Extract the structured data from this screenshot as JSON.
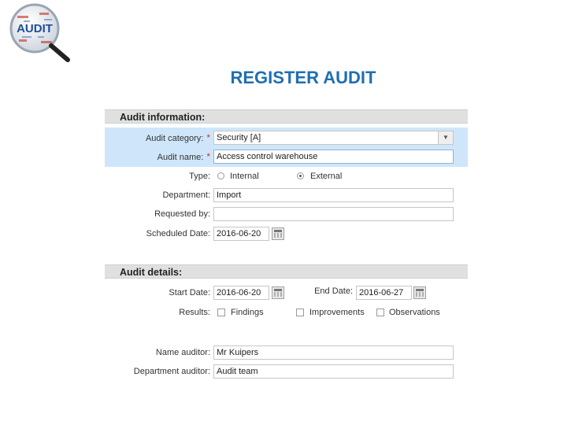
{
  "logo": {
    "text": "AUDIT"
  },
  "page_title": "REGISTER AUDIT",
  "audit_information": {
    "header": "Audit information:",
    "audit_category": {
      "label": "Audit category:",
      "required_mark": "*",
      "value": "Security [A]"
    },
    "audit_name": {
      "label": "Audit name:",
      "required_mark": "*",
      "value": "Access control warehouse"
    },
    "type": {
      "label": "Type:",
      "options": [
        "Internal",
        "External"
      ],
      "selected": "External"
    },
    "department": {
      "label": "Department:",
      "value": "Import"
    },
    "requested_by": {
      "label": "Requested by:",
      "value": ""
    },
    "scheduled_date": {
      "label": "Scheduled Date:",
      "value": "2016-06-20"
    }
  },
  "audit_details": {
    "header": "Audit details:",
    "start_date": {
      "label": "Start Date:",
      "value": "2016-06-20"
    },
    "end_date": {
      "label": "End Date:",
      "value": "2016-06-27"
    },
    "results": {
      "label": "Results:",
      "options": [
        "Findings",
        "Improvements",
        "Observations"
      ],
      "checked": []
    },
    "name_auditor": {
      "label": "Name auditor:",
      "value": "Mr Kuipers"
    },
    "department_auditor": {
      "label": "Department auditor:",
      "value": "Audit team"
    }
  },
  "colors": {
    "title": "#1f6fb2",
    "required": "#d2302d",
    "highlight": "#cfe6fa",
    "section_bg": "#e0e0e0"
  }
}
